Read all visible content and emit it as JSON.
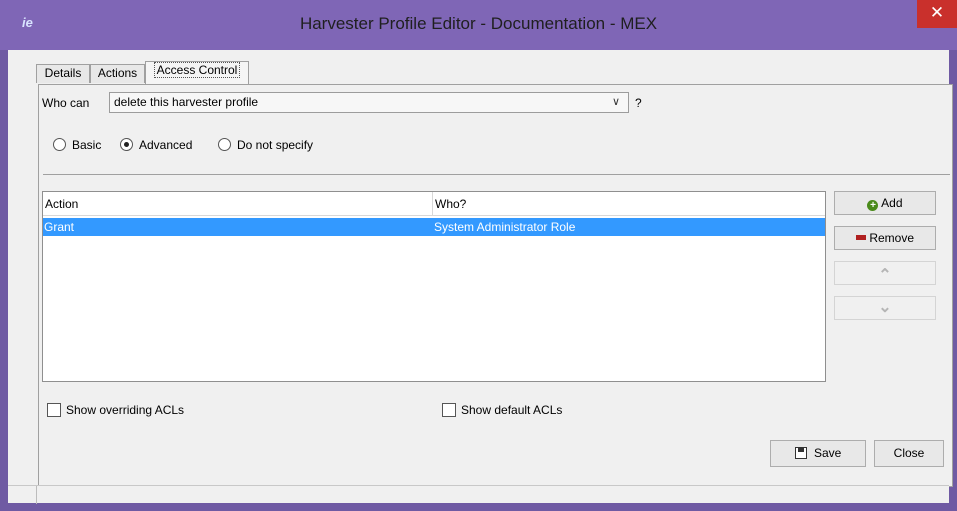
{
  "window": {
    "title": "Harvester Profile Editor - Documentation - MEX",
    "app_icon": "ie",
    "close_symbol": "✕"
  },
  "tabs": [
    {
      "label": "Details",
      "active": false
    },
    {
      "label": "Actions",
      "active": false
    },
    {
      "label": "Access Control",
      "active": true
    }
  ],
  "access": {
    "who_can_label": "Who can",
    "selected_permission": "delete this harvester profile",
    "help_label": "?",
    "modes": [
      {
        "label": "Basic",
        "selected": false
      },
      {
        "label": "Advanced",
        "selected": true
      },
      {
        "label": "Do not specify",
        "selected": false
      }
    ]
  },
  "table": {
    "columns": [
      "Action",
      "Who?"
    ],
    "rows": [
      {
        "action": "Grant",
        "who": "System Administrator Role",
        "selected": true
      }
    ]
  },
  "side_buttons": {
    "add_label": "Add",
    "remove_label": "Remove",
    "up_symbol": "⌃",
    "down_symbol": "⌄"
  },
  "options": {
    "show_overriding_label": "Show overriding ACLs",
    "show_overriding_checked": false,
    "show_default_label": "Show default ACLs",
    "show_default_checked": false
  },
  "footer": {
    "save_label": "Save",
    "close_label": "Close"
  },
  "colors": {
    "titlebar": "#7f66b6",
    "selection": "#3399ff",
    "close_button": "#c9302c",
    "add_icon": "#4a8a1a",
    "remove_icon": "#b02020"
  }
}
